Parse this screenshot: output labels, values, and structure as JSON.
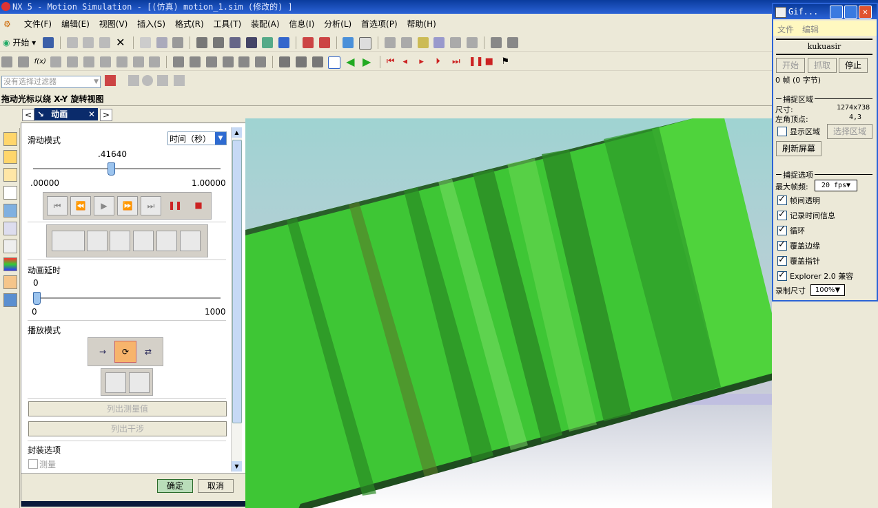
{
  "window": {
    "title": "NX 5 - Motion Simulation - [(仿真) motion_1.sim  (修改的) ]"
  },
  "menu": [
    "文件(F)",
    "编辑(E)",
    "视图(V)",
    "插入(S)",
    "格式(R)",
    "工具(T)",
    "装配(A)",
    "信息(I)",
    "分析(L)",
    "首选项(P)",
    "帮助(H)"
  ],
  "toolbar": {
    "start_label": "开始"
  },
  "filter": {
    "placeholder": "没有选择过滤器"
  },
  "status": {
    "text": "拖动光标以绕 X-Y 旋转视图"
  },
  "dialog": {
    "title": "动画",
    "slide_mode_label": "滑动模式",
    "time_select": "时间（秒）",
    "slider_value": ".41640",
    "slider_fraction": 0.4164,
    "slider_min": ".00000",
    "slider_max": "1.00000",
    "delay_label": "动画延时",
    "delay_value": "0",
    "delay_min": "0",
    "delay_max": "1000",
    "play_mode_label": "播放模式",
    "list_measure": "列出测量值",
    "list_interference": "列出干涉",
    "wrap_label": "封装选项",
    "measure_label": "测量",
    "ok": "确定",
    "cancel": "取消"
  },
  "gif": {
    "title": "Gif...",
    "menu_file": "文件",
    "menu_edit": "编辑",
    "user": "kukuasir",
    "btn_start": "开始",
    "btn_capture": "抓取",
    "btn_stop": "停止",
    "frames": "0 帧 (0 字节)",
    "capture_area": "捕捉区域",
    "size_label": "尺寸:",
    "size_value": "1274x738",
    "corner_label": "左角顶点:",
    "corner_value": "4,3",
    "show_area": "显示区域",
    "select_area": "选择区域",
    "refresh": "刷新屏幕",
    "capture_options": "捕捉选项",
    "max_fps_label": "最大帧频:",
    "max_fps": "20 fps",
    "options": [
      "帧间透明",
      "记录时间信息",
      "循环",
      "覆盖边缘",
      "覆盖指针",
      "Explorer 2.0 兼容"
    ],
    "record_size_label": "录制尺寸",
    "record_size": "100%"
  }
}
